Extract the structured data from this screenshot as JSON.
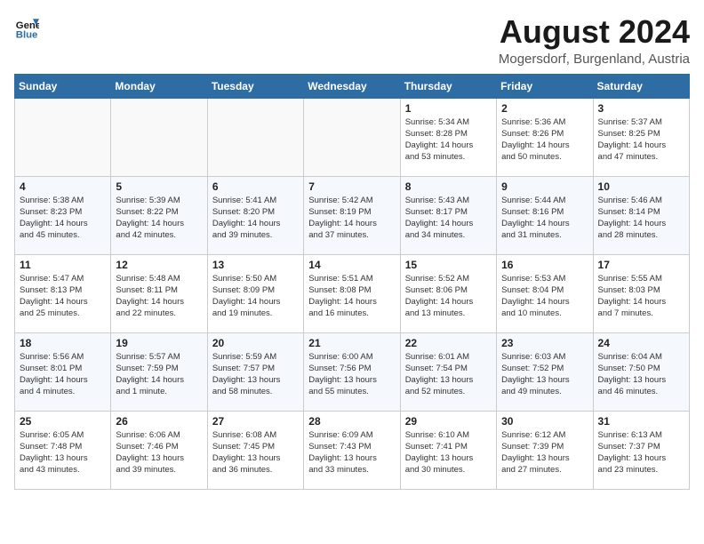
{
  "header": {
    "logo_line1": "General",
    "logo_line2": "Blue",
    "month_year": "August 2024",
    "location": "Mogersdorf, Burgenland, Austria"
  },
  "weekdays": [
    "Sunday",
    "Monday",
    "Tuesday",
    "Wednesday",
    "Thursday",
    "Friday",
    "Saturday"
  ],
  "weeks": [
    [
      {
        "day": "",
        "content": ""
      },
      {
        "day": "",
        "content": ""
      },
      {
        "day": "",
        "content": ""
      },
      {
        "day": "",
        "content": ""
      },
      {
        "day": "1",
        "content": "Sunrise: 5:34 AM\nSunset: 8:28 PM\nDaylight: 14 hours\nand 53 minutes."
      },
      {
        "day": "2",
        "content": "Sunrise: 5:36 AM\nSunset: 8:26 PM\nDaylight: 14 hours\nand 50 minutes."
      },
      {
        "day": "3",
        "content": "Sunrise: 5:37 AM\nSunset: 8:25 PM\nDaylight: 14 hours\nand 47 minutes."
      }
    ],
    [
      {
        "day": "4",
        "content": "Sunrise: 5:38 AM\nSunset: 8:23 PM\nDaylight: 14 hours\nand 45 minutes."
      },
      {
        "day": "5",
        "content": "Sunrise: 5:39 AM\nSunset: 8:22 PM\nDaylight: 14 hours\nand 42 minutes."
      },
      {
        "day": "6",
        "content": "Sunrise: 5:41 AM\nSunset: 8:20 PM\nDaylight: 14 hours\nand 39 minutes."
      },
      {
        "day": "7",
        "content": "Sunrise: 5:42 AM\nSunset: 8:19 PM\nDaylight: 14 hours\nand 37 minutes."
      },
      {
        "day": "8",
        "content": "Sunrise: 5:43 AM\nSunset: 8:17 PM\nDaylight: 14 hours\nand 34 minutes."
      },
      {
        "day": "9",
        "content": "Sunrise: 5:44 AM\nSunset: 8:16 PM\nDaylight: 14 hours\nand 31 minutes."
      },
      {
        "day": "10",
        "content": "Sunrise: 5:46 AM\nSunset: 8:14 PM\nDaylight: 14 hours\nand 28 minutes."
      }
    ],
    [
      {
        "day": "11",
        "content": "Sunrise: 5:47 AM\nSunset: 8:13 PM\nDaylight: 14 hours\nand 25 minutes."
      },
      {
        "day": "12",
        "content": "Sunrise: 5:48 AM\nSunset: 8:11 PM\nDaylight: 14 hours\nand 22 minutes."
      },
      {
        "day": "13",
        "content": "Sunrise: 5:50 AM\nSunset: 8:09 PM\nDaylight: 14 hours\nand 19 minutes."
      },
      {
        "day": "14",
        "content": "Sunrise: 5:51 AM\nSunset: 8:08 PM\nDaylight: 14 hours\nand 16 minutes."
      },
      {
        "day": "15",
        "content": "Sunrise: 5:52 AM\nSunset: 8:06 PM\nDaylight: 14 hours\nand 13 minutes."
      },
      {
        "day": "16",
        "content": "Sunrise: 5:53 AM\nSunset: 8:04 PM\nDaylight: 14 hours\nand 10 minutes."
      },
      {
        "day": "17",
        "content": "Sunrise: 5:55 AM\nSunset: 8:03 PM\nDaylight: 14 hours\nand 7 minutes."
      }
    ],
    [
      {
        "day": "18",
        "content": "Sunrise: 5:56 AM\nSunset: 8:01 PM\nDaylight: 14 hours\nand 4 minutes."
      },
      {
        "day": "19",
        "content": "Sunrise: 5:57 AM\nSunset: 7:59 PM\nDaylight: 14 hours\nand 1 minute."
      },
      {
        "day": "20",
        "content": "Sunrise: 5:59 AM\nSunset: 7:57 PM\nDaylight: 13 hours\nand 58 minutes."
      },
      {
        "day": "21",
        "content": "Sunrise: 6:00 AM\nSunset: 7:56 PM\nDaylight: 13 hours\nand 55 minutes."
      },
      {
        "day": "22",
        "content": "Sunrise: 6:01 AM\nSunset: 7:54 PM\nDaylight: 13 hours\nand 52 minutes."
      },
      {
        "day": "23",
        "content": "Sunrise: 6:03 AM\nSunset: 7:52 PM\nDaylight: 13 hours\nand 49 minutes."
      },
      {
        "day": "24",
        "content": "Sunrise: 6:04 AM\nSunset: 7:50 PM\nDaylight: 13 hours\nand 46 minutes."
      }
    ],
    [
      {
        "day": "25",
        "content": "Sunrise: 6:05 AM\nSunset: 7:48 PM\nDaylight: 13 hours\nand 43 minutes."
      },
      {
        "day": "26",
        "content": "Sunrise: 6:06 AM\nSunset: 7:46 PM\nDaylight: 13 hours\nand 39 minutes."
      },
      {
        "day": "27",
        "content": "Sunrise: 6:08 AM\nSunset: 7:45 PM\nDaylight: 13 hours\nand 36 minutes."
      },
      {
        "day": "28",
        "content": "Sunrise: 6:09 AM\nSunset: 7:43 PM\nDaylight: 13 hours\nand 33 minutes."
      },
      {
        "day": "29",
        "content": "Sunrise: 6:10 AM\nSunset: 7:41 PM\nDaylight: 13 hours\nand 30 minutes."
      },
      {
        "day": "30",
        "content": "Sunrise: 6:12 AM\nSunset: 7:39 PM\nDaylight: 13 hours\nand 27 minutes."
      },
      {
        "day": "31",
        "content": "Sunrise: 6:13 AM\nSunset: 7:37 PM\nDaylight: 13 hours\nand 23 minutes."
      }
    ]
  ]
}
